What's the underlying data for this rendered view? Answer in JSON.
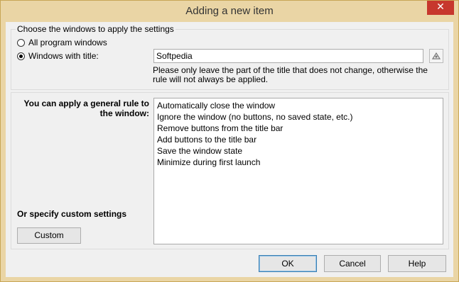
{
  "window": {
    "title": "Adding a new item",
    "close_label": "✕"
  },
  "windows_group": {
    "title": "Choose the windows to apply the settings",
    "option_all": "All program windows",
    "option_title": "Windows with title:",
    "selected": "title",
    "title_value": "Softpedia",
    "note": "Please only leave the part of the title that does not change, otherwise the rule will not always be applied."
  },
  "rules_group": {
    "label": "You can apply a general rule to the window:",
    "rules": [
      "Automatically close the window",
      "Ignore the window (no buttons, no saved state, etc.)",
      "Remove buttons from the title bar",
      "Add buttons to the title bar",
      "Save the window state",
      "Minimize during first launch"
    ],
    "custom_label": "Or specify custom settings",
    "custom_button": "Custom"
  },
  "footer": {
    "ok": "OK",
    "cancel": "Cancel",
    "help": "Help"
  },
  "icons": {
    "close": "close-icon",
    "picker": "window-picker-icon"
  }
}
